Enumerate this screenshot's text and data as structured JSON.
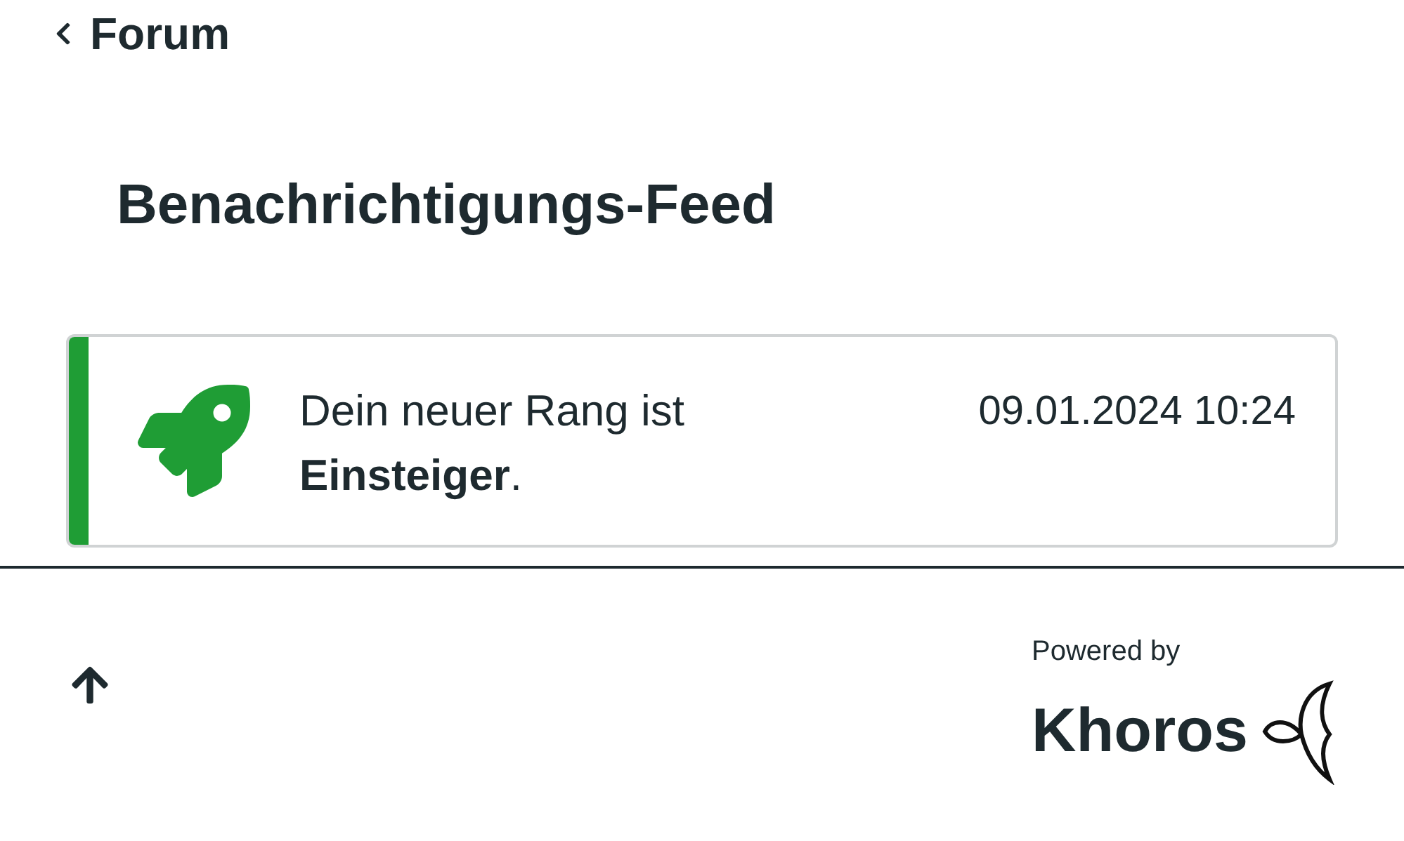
{
  "back_link": {
    "label": "Forum"
  },
  "title": "Benachrichtigungs-Feed",
  "notifications": [
    {
      "kind": "rank",
      "message": "Dein neuer Rang ist **Einsteiger**.",
      "time": "09.01.2024 10:24"
    }
  ],
  "footer": {
    "powered_by": "Powered by",
    "brand": "Khoros"
  }
}
